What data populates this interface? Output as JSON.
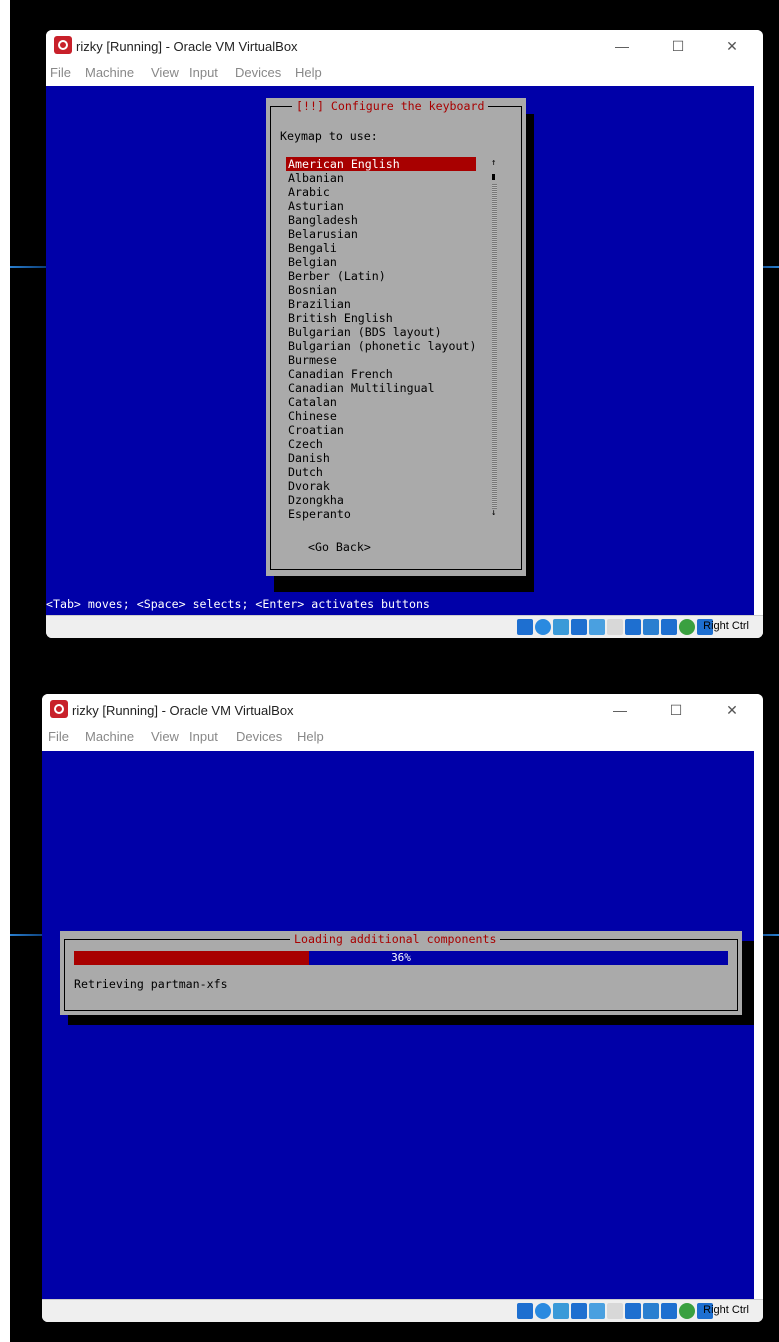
{
  "window1": {
    "title": "rizky [Running] - Oracle VM VirtualBox",
    "menu": [
      "File",
      "Machine",
      "View",
      "Input",
      "Devices",
      "Help"
    ],
    "controls": {
      "minimize": "—",
      "maximize": "☐",
      "close": "✕"
    },
    "dialog": {
      "title": "[!!] Configure the keyboard",
      "prompt": "Keymap to use:",
      "selected": "American English",
      "items": [
        "American English",
        "Albanian",
        "Arabic",
        "Asturian",
        "Bangladesh",
        "Belarusian",
        "Bengali",
        "Belgian",
        "Berber (Latin)",
        "Bosnian",
        "Brazilian",
        "British English",
        "Bulgarian (BDS layout)",
        "Bulgarian (phonetic layout)",
        "Burmese",
        "Canadian French",
        "Canadian Multilingual",
        "Catalan",
        "Chinese",
        "Croatian",
        "Czech",
        "Danish",
        "Dutch",
        "Dvorak",
        "Dzongkha",
        "Esperanto"
      ],
      "go_back": "<Go Back>",
      "scroll_up": "↑",
      "scroll_down": "↓"
    },
    "hint": "<Tab> moves; <Space> selects; <Enter> activates buttons",
    "host_key": "Right Ctrl"
  },
  "window2": {
    "title": "rizky [Running] - Oracle VM VirtualBox",
    "menu": [
      "File",
      "Machine",
      "View",
      "Input",
      "Devices",
      "Help"
    ],
    "controls": {
      "minimize": "—",
      "maximize": "☐",
      "close": "✕"
    },
    "dialog": {
      "title": "Loading additional components",
      "progress_percent": 36,
      "progress_label": "36%",
      "status": "Retrieving partman-xfs"
    },
    "host_key": "Right Ctrl"
  },
  "colors": {
    "vm_background": "#0000a8",
    "dialog_gray": "#aaaaaa",
    "selection_red": "#a80000",
    "status_icons": [
      "#1e6fd0",
      "#2a8ae0",
      "#3a9ad8",
      "#1e6fd0",
      "#4aa0e0",
      "#d8d8d8",
      "#1e6fd0",
      "#2a7fd0",
      "#1e6fd0",
      "#3aa040",
      "#1e6fd0"
    ]
  }
}
